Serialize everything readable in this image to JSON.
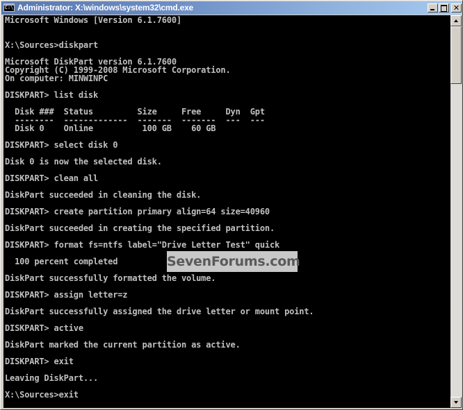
{
  "window": {
    "title": "Administrator: X:\\windows\\system32\\cmd.exe",
    "icon": "cmd-icon",
    "icon_label": "C:\\",
    "buttons": {
      "minimize": "minimize",
      "maximize": "maximize",
      "close": "✕"
    }
  },
  "console": {
    "lines": [
      "Microsoft Windows [Version 6.1.7600]",
      "",
      "",
      "X:\\Sources>diskpart",
      "",
      "Microsoft DiskPart version 6.1.7600",
      "Copyright (C) 1999-2008 Microsoft Corporation.",
      "On computer: MINWINPC",
      "",
      "DISKPART> list disk",
      "",
      "  Disk ###  Status         Size     Free     Dyn  Gpt",
      "  --------  -------------  -------  -------  ---  ---",
      "  Disk 0    Online          100 GB    60 GB",
      "",
      "DISKPART> select disk 0",
      "",
      "Disk 0 is now the selected disk.",
      "",
      "DISKPART> clean all",
      "",
      "DiskPart succeeded in cleaning the disk.",
      "",
      "DISKPART> create partition primary align=64 size=40960",
      "",
      "DiskPart succeeded in creating the specified partition.",
      "",
      "DISKPART> format fs=ntfs label=\"Drive Letter Test\" quick",
      "",
      "  100 percent completed",
      "",
      "DiskPart successfully formatted the volume.",
      "",
      "DISKPART> assign letter=z",
      "",
      "DiskPart successfully assigned the drive letter or mount point.",
      "",
      "DISKPART> active",
      "",
      "DiskPart marked the current partition as active.",
      "",
      "DISKPART> exit",
      "",
      "Leaving DiskPart...",
      "",
      "X:\\Sources>exit",
      ""
    ]
  },
  "watermark": {
    "text": "SevenForums.com"
  },
  "scrollbar": {
    "position": 0.0
  }
}
